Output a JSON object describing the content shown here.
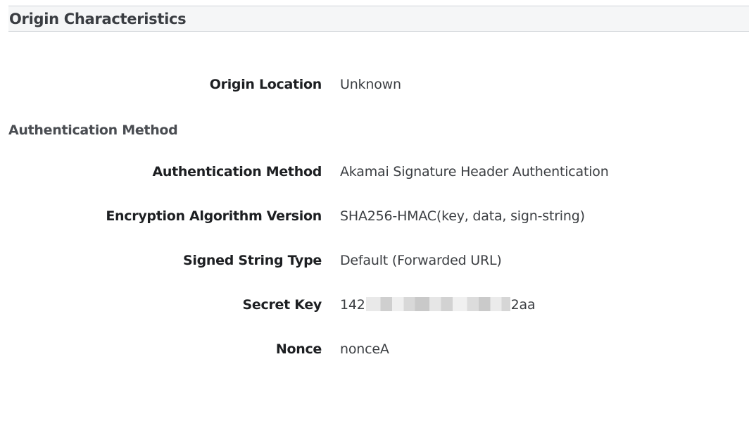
{
  "section": {
    "title": "Origin Characteristics"
  },
  "origin": {
    "location_label": "Origin Location",
    "location_value": "Unknown"
  },
  "auth": {
    "subheading": "Authentication Method",
    "rows": [
      {
        "label": "Authentication Method",
        "value": "Akamai Signature Header Authentication"
      },
      {
        "label": "Encryption Algorithm Version",
        "value": "SHA256-HMAC(key, data, sign-string)"
      },
      {
        "label": "Signed String Type",
        "value": "Default (Forwarded URL)"
      },
      {
        "label": "Secret Key",
        "value_prefix": "142",
        "value_suffix": "2aa"
      },
      {
        "label": "Nonce",
        "value": "nonceA"
      }
    ]
  }
}
